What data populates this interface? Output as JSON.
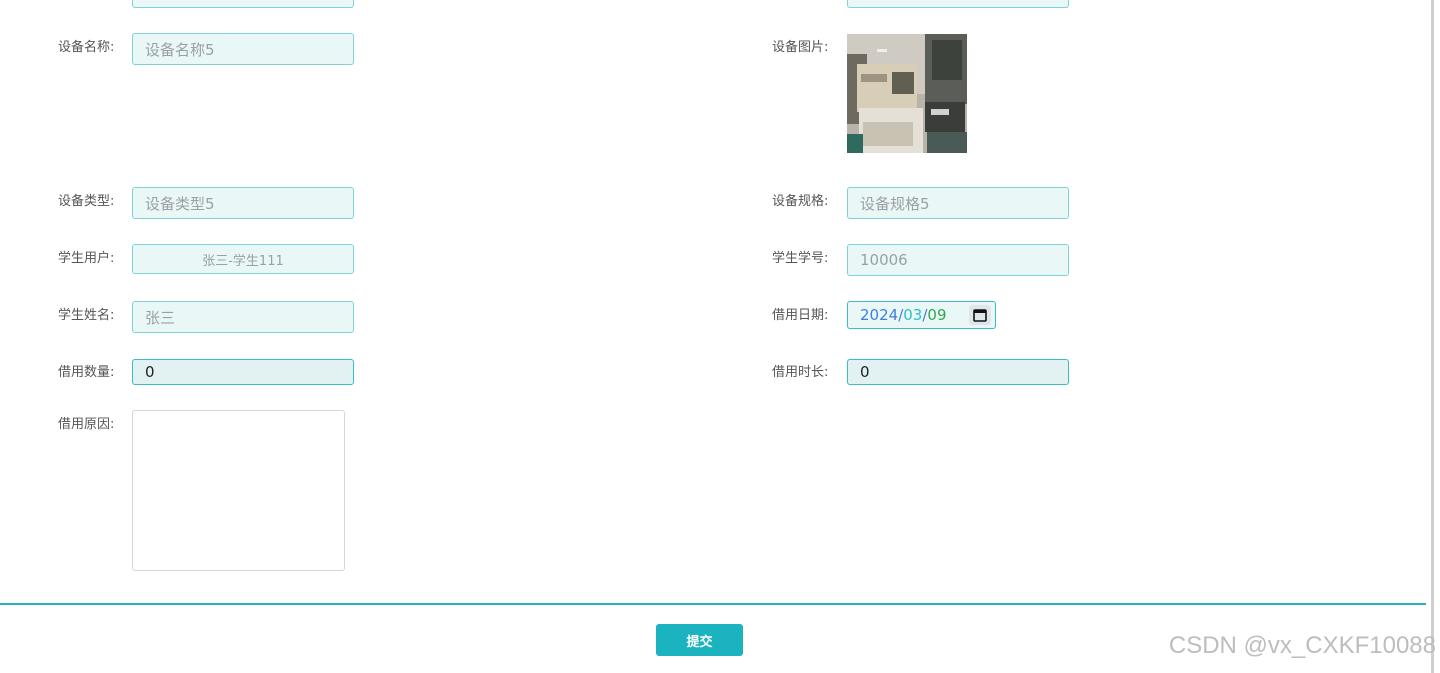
{
  "form": {
    "device_name": {
      "label": "设备名称:",
      "placeholder": "设备名称5"
    },
    "device_image": {
      "label": "设备图片:"
    },
    "device_type": {
      "label": "设备类型:",
      "placeholder": "设备类型5"
    },
    "device_spec": {
      "label": "设备规格:",
      "placeholder": "设备规格5"
    },
    "student_user": {
      "label": "学生用户:",
      "value": "张三-学生111"
    },
    "student_no": {
      "label": "学生学号:",
      "value": "10006"
    },
    "student_name": {
      "label": "学生姓名:",
      "value": "张三"
    },
    "borrow_date": {
      "label": "借用日期:",
      "year": "2024",
      "sep1": "/",
      "month": "03",
      "sep2": "/",
      "day": "09"
    },
    "borrow_qty": {
      "label": "借用数量:",
      "value": "0"
    },
    "borrow_duration": {
      "label": "借用时长:",
      "value": "0"
    },
    "borrow_reason": {
      "label": "借用原因:",
      "value": ""
    }
  },
  "actions": {
    "submit_label": "提交"
  },
  "watermark": "CSDN @vx_CXKF10088",
  "icons": {
    "calendar": "calendar-icon",
    "resize": "resize-handle-icon"
  },
  "colors": {
    "accent": "#1ab3bf",
    "input_bg": "#eaf7f7",
    "input_border": "#7fd3d8"
  }
}
